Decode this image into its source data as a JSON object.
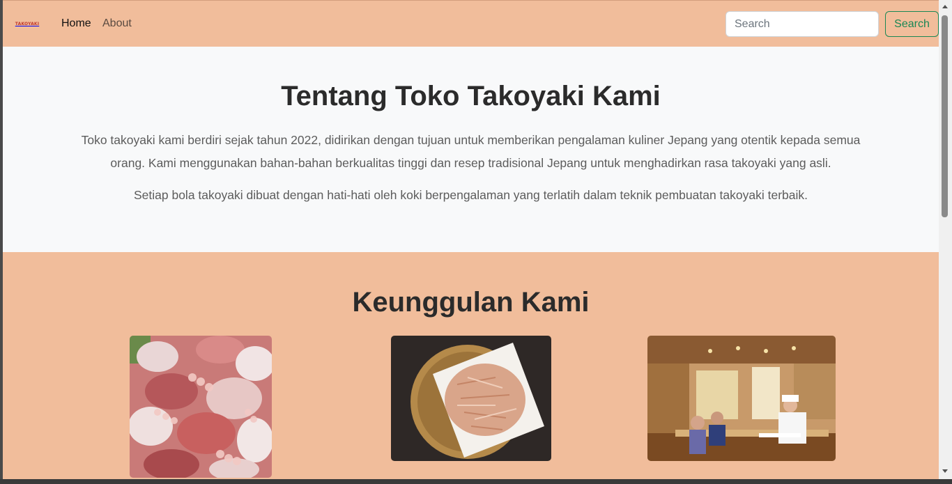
{
  "navbar": {
    "brand_text": "TAKOYAKI",
    "links": [
      {
        "label": "Home"
      },
      {
        "label": "About"
      }
    ],
    "search_placeholder": "Search",
    "search_button_label": "Search"
  },
  "about": {
    "title": "Tentang Toko Takoyaki Kami",
    "paragraph1": "Toko takoyaki kami berdiri sejak tahun 2022, didirikan dengan tujuan untuk memberikan pengalaman kuliner Jepang yang otentik kepada semua orang. Kami menggunakan bahan-bahan berkualitas tinggi dan resep tradisional Jepang untuk menghadirkan rasa takoyaki yang asli.",
    "paragraph2": "Setiap bola takoyaki dibuat dengan hati-hati oleh koki berpengalaman yang terlatih dalam teknik pembuatan takoyaki terbaik."
  },
  "features": {
    "title": "Keunggulan Kami"
  },
  "colors": {
    "accent_peach": "#f1bd9b",
    "light_bg": "#f8f9fa",
    "success_green": "#198754"
  }
}
